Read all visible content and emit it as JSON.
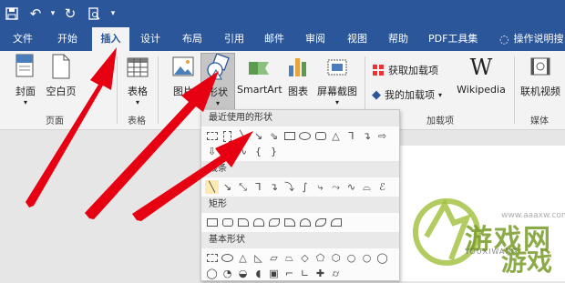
{
  "tabs": [
    "文件",
    "开始",
    "插入",
    "设计",
    "布局",
    "引用",
    "邮件",
    "审阅",
    "视图",
    "帮助",
    "PDF工具集"
  ],
  "tell_me": "操作说明搜",
  "ribbon": {
    "cover": "封面",
    "blank": "空白页",
    "table": "表格",
    "picture": "图片",
    "shapes": "形状",
    "smartart": "SmartArt",
    "chart": "图表",
    "screenshot": "屏幕截图",
    "get_addins": "获取加载项",
    "my_addins": "我的加载项",
    "wikipedia": "Wikipedia",
    "online_video": "联机视频",
    "group_pages": "页面",
    "group_tables": "表格",
    "group_addins": "加载项",
    "group_media": "媒体"
  },
  "dropdown": {
    "recent": "最近使用的形状",
    "lines": "线条",
    "rect": "矩形",
    "basic": "基本形状"
  },
  "watermark": {
    "text1": "游戏网",
    "text2": "游戏",
    "url": "www.aaaxw.com",
    "sub": "YOUXIWANG"
  },
  "colors": {
    "brand": "#2b579a",
    "arrow": "#e60012"
  }
}
